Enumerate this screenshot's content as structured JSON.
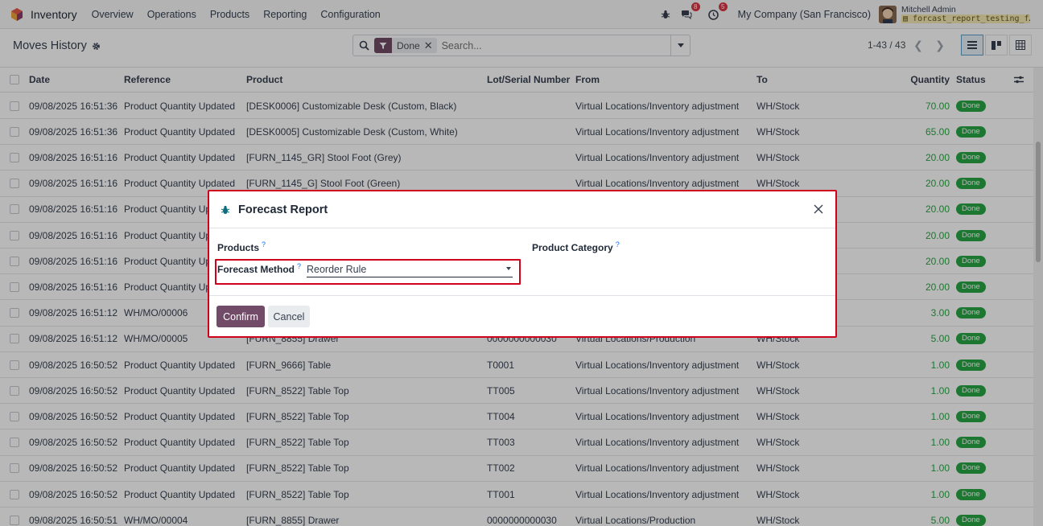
{
  "navbar": {
    "app_name": "Inventory",
    "menu": [
      "Overview",
      "Operations",
      "Products",
      "Reporting",
      "Configuration"
    ],
    "chat_count": "8",
    "activity_count": "5",
    "company": "My Company (San Francisco)",
    "user_name": "Mitchell Admin",
    "db_name": "forcast_report_testing_f…"
  },
  "control": {
    "title": "Moves History",
    "facet_value": "Done",
    "search_placeholder": "Search...",
    "pager": "1-43 / 43"
  },
  "table": {
    "headers": {
      "date": "Date",
      "reference": "Reference",
      "product": "Product",
      "lot": "Lot/Serial Number",
      "from": "From",
      "to": "To",
      "quantity": "Quantity",
      "status": "Status"
    },
    "rows": [
      {
        "date": "09/08/2025 16:51:36",
        "reference": "Product Quantity Updated",
        "product": "[DESK0006] Customizable Desk (Custom, Black)",
        "lot": "",
        "from": "Virtual Locations/Inventory adjustment",
        "to": "WH/Stock",
        "quantity": "70.00",
        "status": "Done"
      },
      {
        "date": "09/08/2025 16:51:36",
        "reference": "Product Quantity Updated",
        "product": "[DESK0005] Customizable Desk (Custom, White)",
        "lot": "",
        "from": "Virtual Locations/Inventory adjustment",
        "to": "WH/Stock",
        "quantity": "65.00",
        "status": "Done"
      },
      {
        "date": "09/08/2025 16:51:16",
        "reference": "Product Quantity Updated",
        "product": "[FURN_1145_GR] Stool Foot (Grey)",
        "lot": "",
        "from": "Virtual Locations/Inventory adjustment",
        "to": "WH/Stock",
        "quantity": "20.00",
        "status": "Done"
      },
      {
        "date": "09/08/2025 16:51:16",
        "reference": "Product Quantity Updated",
        "product": "[FURN_1145_G] Stool Foot (Green)",
        "lot": "",
        "from": "Virtual Locations/Inventory adjustment",
        "to": "WH/Stock",
        "quantity": "20.00",
        "status": "Done"
      },
      {
        "date": "09/08/2025 16:51:16",
        "reference": "Product Quantity Updated",
        "product": "",
        "lot": "",
        "from": "",
        "to": "",
        "quantity": "20.00",
        "status": "Done"
      },
      {
        "date": "09/08/2025 16:51:16",
        "reference": "Product Quantity Updated",
        "product": "",
        "lot": "",
        "from": "",
        "to": "",
        "quantity": "20.00",
        "status": "Done"
      },
      {
        "date": "09/08/2025 16:51:16",
        "reference": "Product Quantity Updated",
        "product": "",
        "lot": "",
        "from": "",
        "to": "",
        "quantity": "20.00",
        "status": "Done"
      },
      {
        "date": "09/08/2025 16:51:16",
        "reference": "Product Quantity Updated",
        "product": "",
        "lot": "",
        "from": "",
        "to": "",
        "quantity": "20.00",
        "status": "Done"
      },
      {
        "date": "09/08/2025 16:51:12",
        "reference": "WH/MO/00006",
        "product": "",
        "lot": "",
        "from": "",
        "to": "",
        "quantity": "3.00",
        "status": "Done"
      },
      {
        "date": "09/08/2025 16:51:12",
        "reference": "WH/MO/00005",
        "product": "[FURN_8855] Drawer",
        "lot": "0000000000030",
        "from": "Virtual Locations/Production",
        "to": "WH/Stock",
        "quantity": "5.00",
        "status": "Done"
      },
      {
        "date": "09/08/2025 16:50:52",
        "reference": "Product Quantity Updated",
        "product": "[FURN_9666] Table",
        "lot": "T0001",
        "from": "Virtual Locations/Inventory adjustment",
        "to": "WH/Stock",
        "quantity": "1.00",
        "status": "Done"
      },
      {
        "date": "09/08/2025 16:50:52",
        "reference": "Product Quantity Updated",
        "product": "[FURN_8522] Table Top",
        "lot": "TT005",
        "from": "Virtual Locations/Inventory adjustment",
        "to": "WH/Stock",
        "quantity": "1.00",
        "status": "Done"
      },
      {
        "date": "09/08/2025 16:50:52",
        "reference": "Product Quantity Updated",
        "product": "[FURN_8522] Table Top",
        "lot": "TT004",
        "from": "Virtual Locations/Inventory adjustment",
        "to": "WH/Stock",
        "quantity": "1.00",
        "status": "Done"
      },
      {
        "date": "09/08/2025 16:50:52",
        "reference": "Product Quantity Updated",
        "product": "[FURN_8522] Table Top",
        "lot": "TT003",
        "from": "Virtual Locations/Inventory adjustment",
        "to": "WH/Stock",
        "quantity": "1.00",
        "status": "Done"
      },
      {
        "date": "09/08/2025 16:50:52",
        "reference": "Product Quantity Updated",
        "product": "[FURN_8522] Table Top",
        "lot": "TT002",
        "from": "Virtual Locations/Inventory adjustment",
        "to": "WH/Stock",
        "quantity": "1.00",
        "status": "Done"
      },
      {
        "date": "09/08/2025 16:50:52",
        "reference": "Product Quantity Updated",
        "product": "[FURN_8522] Table Top",
        "lot": "TT001",
        "from": "Virtual Locations/Inventory adjustment",
        "to": "WH/Stock",
        "quantity": "1.00",
        "status": "Done"
      },
      {
        "date": "09/08/2025 16:50:51",
        "reference": "WH/MO/00004",
        "product": "[FURN_8855] Drawer",
        "lot": "0000000000030",
        "from": "Virtual Locations/Production",
        "to": "WH/Stock",
        "quantity": "5.00",
        "status": "Done"
      }
    ]
  },
  "modal": {
    "title": "Forecast Report",
    "products_label": "Products",
    "category_label": "Product Category",
    "method_label": "Forecast Method",
    "method_value": "Reorder Rule",
    "tooltip_mark": "?",
    "confirm_label": "Confirm",
    "cancel_label": "Cancel"
  },
  "colors": {
    "brand": "#714b67",
    "done_green": "#28a745",
    "highlight_red": "#d0021b",
    "badge_red": "#dc3545"
  }
}
